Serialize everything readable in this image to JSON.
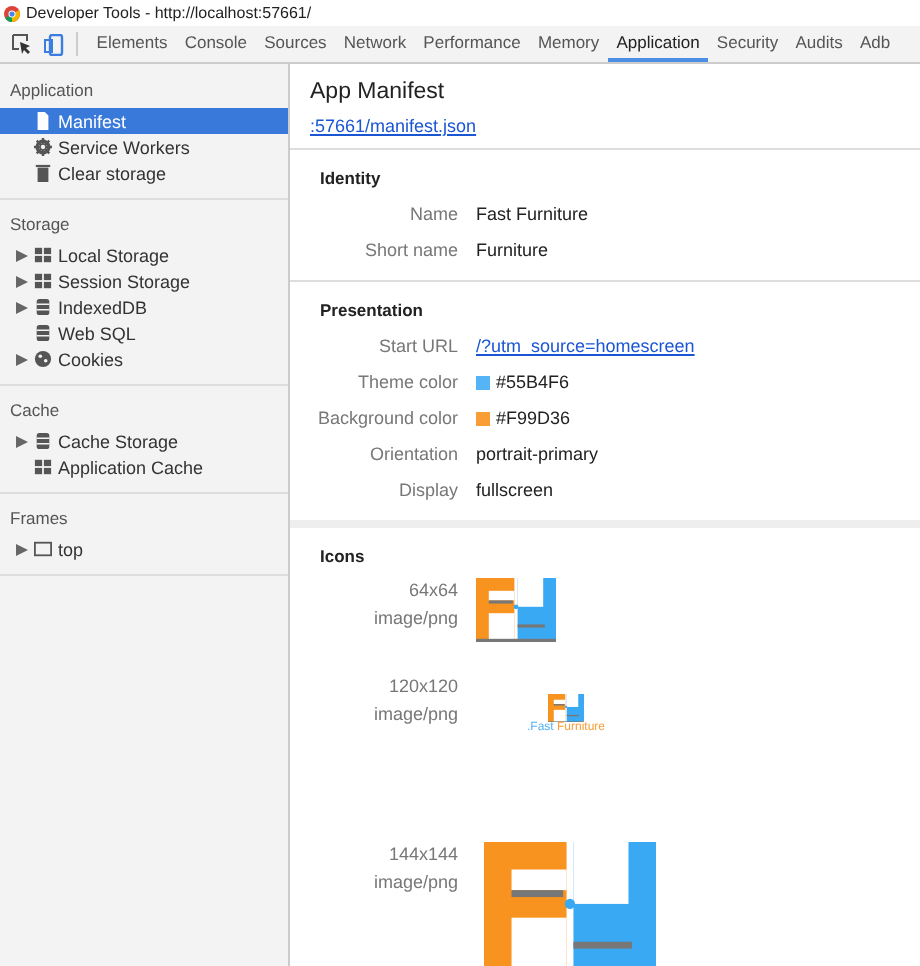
{
  "window": {
    "title": "Developer Tools - http://localhost:57661/"
  },
  "tabs": [
    {
      "label": "Elements",
      "selected": false
    },
    {
      "label": "Console",
      "selected": false
    },
    {
      "label": "Sources",
      "selected": false
    },
    {
      "label": "Network",
      "selected": false
    },
    {
      "label": "Performance",
      "selected": false
    },
    {
      "label": "Memory",
      "selected": false
    },
    {
      "label": "Application",
      "selected": true
    },
    {
      "label": "Security",
      "selected": false
    },
    {
      "label": "Audits",
      "selected": false
    },
    {
      "label": "Adb",
      "selected": false
    }
  ],
  "sidebar": {
    "sections": [
      {
        "title": "Application",
        "items": [
          {
            "label": "Manifest",
            "kind": "file",
            "expandable": false,
            "selected": true
          },
          {
            "label": "Service Workers",
            "kind": "gear",
            "expandable": false,
            "selected": false
          },
          {
            "label": "Clear storage",
            "kind": "trash",
            "expandable": false,
            "selected": false
          }
        ]
      },
      {
        "title": "Storage",
        "items": [
          {
            "label": "Local Storage",
            "kind": "grid",
            "expandable": true,
            "selected": false
          },
          {
            "label": "Session Storage",
            "kind": "grid",
            "expandable": true,
            "selected": false
          },
          {
            "label": "IndexedDB",
            "kind": "database",
            "expandable": true,
            "selected": false
          },
          {
            "label": "Web SQL",
            "kind": "database",
            "expandable": false,
            "selected": false
          },
          {
            "label": "Cookies",
            "kind": "cookie",
            "expandable": true,
            "selected": false
          }
        ]
      },
      {
        "title": "Cache",
        "items": [
          {
            "label": "Cache Storage",
            "kind": "database",
            "expandable": true,
            "selected": false
          },
          {
            "label": "Application Cache",
            "kind": "grid",
            "expandable": false,
            "selected": false
          }
        ]
      },
      {
        "title": "Frames",
        "items": [
          {
            "label": "top",
            "kind": "frame",
            "expandable": true,
            "selected": false
          }
        ]
      }
    ]
  },
  "main": {
    "title": "App Manifest",
    "manifest_link": ":57661/manifest.json",
    "sections": [
      {
        "title": "Identity",
        "rows": [
          {
            "label": "Name",
            "value": "Fast Furniture",
            "kind": "text"
          },
          {
            "label": "Short name",
            "value": "Furniture",
            "kind": "text"
          }
        ]
      },
      {
        "title": "Presentation",
        "rows": [
          {
            "label": "Start URL",
            "value": "/?utm_source=homescreen",
            "kind": "link"
          },
          {
            "label": "Theme color",
            "value": "#55B4F6",
            "kind": "color",
            "color": "#55b4f6"
          },
          {
            "label": "Background color",
            "value": "#F99D36",
            "kind": "color",
            "color": "#f99d36"
          },
          {
            "label": "Orientation",
            "value": "portrait-primary",
            "kind": "text"
          },
          {
            "label": "Display",
            "value": "fullscreen",
            "kind": "text"
          }
        ]
      }
    ],
    "icons": {
      "title": "Icons",
      "items": [
        {
          "size": "64x64",
          "type": "image/png",
          "kind": "small"
        },
        {
          "size": "120x120",
          "type": "image/png",
          "kind": "wordmark",
          "caption_prefix": ".Fast ",
          "caption_rest": "Furniture"
        },
        {
          "size": "144x144",
          "type": "image/png",
          "kind": "large"
        }
      ]
    }
  }
}
